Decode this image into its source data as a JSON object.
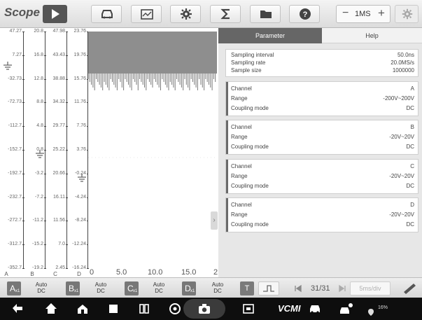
{
  "app": {
    "title": "Scope"
  },
  "toolbar": {
    "play_icon": "play-icon",
    "icons": [
      "car-icon",
      "report-icon",
      "gear-icon",
      "sigma-icon",
      "folder-icon",
      "help-icon"
    ],
    "timebase": "1MS",
    "settings_icon": "settings-icon"
  },
  "scope": {
    "channel_labels": [
      "A",
      "B",
      "C",
      "D"
    ],
    "scales": {
      "A": [
        "47.27",
        "7.27",
        "-32.73",
        "-72.73",
        "-112.7",
        "-152.7",
        "-192.7",
        "-232.7",
        "-272.7",
        "-312.7",
        "-352.7"
      ],
      "B": [
        "20.8",
        "16.8",
        "12.8",
        "8.8",
        "4.8",
        "0.8",
        "-3.2",
        "-7.2",
        "-11.2",
        "-15.2",
        "-19.2"
      ],
      "C": [
        "47.98",
        "43.43",
        "38.88",
        "34.32",
        "29.77",
        "25.22",
        "20.66",
        "16.11",
        "11.56",
        "7.0",
        "2.45"
      ],
      "D": [
        "23.76",
        "19.76",
        "15.76",
        "11.76",
        "7.76",
        "3.76",
        "-0.24",
        "-4.24",
        "-8.24",
        "-12.24",
        "-16.24"
      ]
    },
    "x_labels": [
      "0",
      "5.0",
      "10.0",
      "15.0",
      "2"
    ]
  },
  "panel": {
    "tabs": {
      "parameter": "Parameter",
      "help": "Help"
    },
    "sampling": {
      "interval_label": "Sampling interval",
      "interval_value": "50.0ns",
      "rate_label": "Sampling rate",
      "rate_value": "20.0MS/s",
      "size_label": "Sample size",
      "size_value": "1000000"
    },
    "channels": [
      {
        "channel_label": "Channel",
        "channel": "A",
        "range_label": "Range",
        "range": "-200V~200V",
        "coupling_label": "Coupling mode",
        "coupling": "DC"
      },
      {
        "channel_label": "Channel",
        "channel": "B",
        "range_label": "Range",
        "range": "-20V~20V",
        "coupling_label": "Coupling mode",
        "coupling": "DC"
      },
      {
        "channel_label": "Channel",
        "channel": "C",
        "range_label": "Range",
        "range": "-20V~20V",
        "coupling_label": "Coupling mode",
        "coupling": "DC"
      },
      {
        "channel_label": "Channel",
        "channel": "D",
        "range_label": "Range",
        "range": "-20V~20V",
        "coupling_label": "Coupling mode",
        "coupling": "DC"
      }
    ]
  },
  "bottom": {
    "channels": [
      {
        "letter": "A",
        "sub": "x1",
        "mode": "Auto",
        "coupling": "DC"
      },
      {
        "letter": "B",
        "sub": "x1",
        "mode": "Auto",
        "coupling": "DC"
      },
      {
        "letter": "C",
        "sub": "x1",
        "mode": "Auto",
        "coupling": "DC"
      },
      {
        "letter": "D",
        "sub": "x1",
        "mode": "Auto",
        "coupling": "DC"
      }
    ],
    "trigger": "T",
    "page": "31/31",
    "zoom": "5ms/div"
  },
  "system": {
    "vcm": "VCMI",
    "status": "16%"
  },
  "colors": {
    "active_tab": "#666666",
    "channel_button": "#777777",
    "system_bar": "#0e0e0e"
  }
}
